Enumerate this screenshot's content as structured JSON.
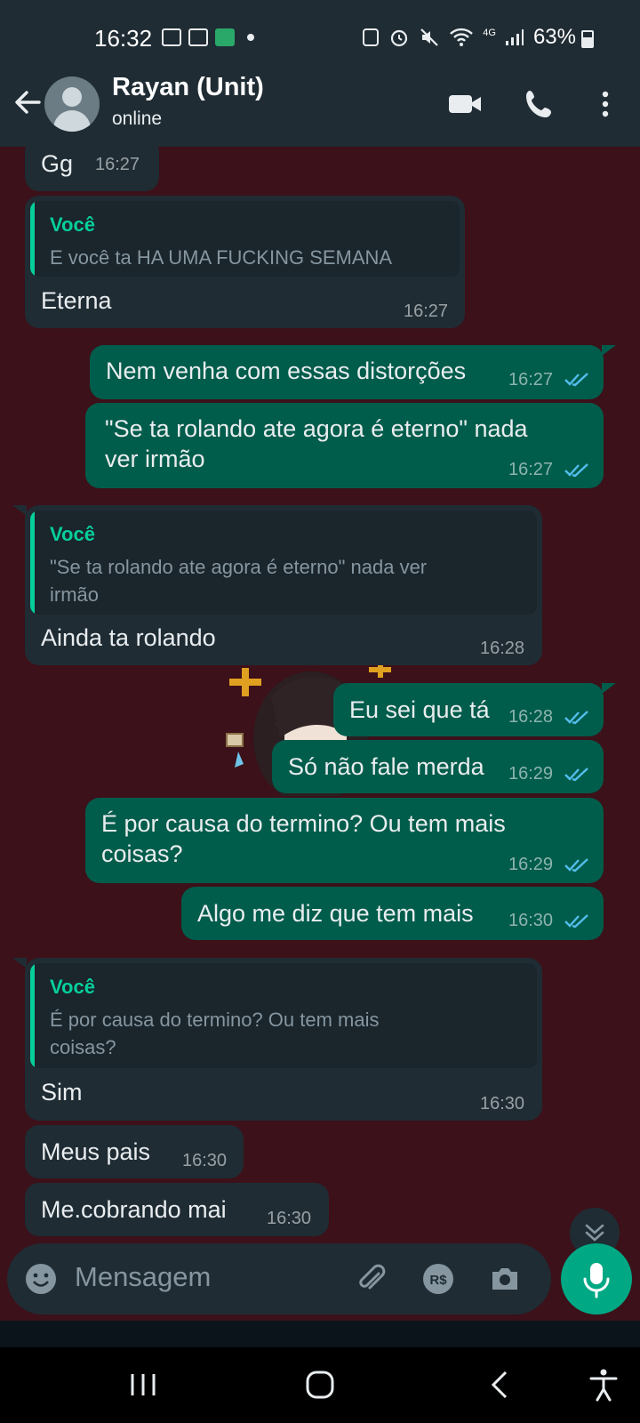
{
  "status_bar": {
    "time": "16:32",
    "network": "4G",
    "battery": "63%",
    "battery_level": 0.63,
    "left_icons": [
      "gallery-icon",
      "screen-share-icon",
      "brain-app-icon"
    ],
    "right_icons": [
      "recycle-icon",
      "alarm-icon",
      "mute-icon",
      "wifi-icon",
      "signal-icon",
      "battery-icon"
    ]
  },
  "header": {
    "contact_name": "Rayan (Unit)",
    "contact_status": "online",
    "icons": [
      "back-arrow-icon",
      "video-call-icon",
      "phone-icon",
      "more-vert-icon"
    ]
  },
  "messages": [
    {
      "dir": "in",
      "text": "Gg",
      "time": "16:27"
    },
    {
      "dir": "in",
      "quote_author": "Você",
      "quote_text": "E você ta HA UMA FUCKING SEMANA",
      "text": "Eterna",
      "time": "16:27"
    },
    {
      "dir": "out",
      "text": "Nem venha com essas distorções",
      "time": "16:27",
      "read": true
    },
    {
      "dir": "out",
      "text": "\"Se ta rolando ate agora é eterno\" nada\nver irmão",
      "time": "16:27",
      "read": true
    },
    {
      "dir": "in",
      "quote_author": "Você",
      "quote_text": "\"Se ta rolando ate agora é eterno\" nada ver\nirmão",
      "text": "Ainda ta rolando",
      "time": "16:28"
    },
    {
      "dir": "out",
      "text": "Eu sei que tá",
      "time": "16:28",
      "read": true
    },
    {
      "dir": "out",
      "text": "Só não fale merda",
      "time": "16:29",
      "read": true
    },
    {
      "dir": "out",
      "text": "É por causa do termino? Ou tem mais\ncoisas?",
      "time": "16:29",
      "read": true
    },
    {
      "dir": "out",
      "text": "Algo me diz que tem mais",
      "time": "16:30",
      "read": true
    },
    {
      "dir": "in",
      "quote_author": "Você",
      "quote_text": "É por causa do termino? Ou tem mais\ncoisas?",
      "text": "Sim",
      "time": "16:30"
    },
    {
      "dir": "in",
      "text": "Meus pais",
      "time": "16:30"
    },
    {
      "dir": "in",
      "text": "Me.cobrando mai",
      "time": "16:30"
    }
  ],
  "compose": {
    "placeholder": "Mensagem",
    "icons": [
      "emoji-icon",
      "attach-icon",
      "payment-icon",
      "camera-icon",
      "mic-icon"
    ]
  },
  "navigation": {
    "icons": [
      "recent-apps-icon",
      "home-icon",
      "back-icon",
      "accessibility-icon"
    ]
  },
  "colors": {
    "header_bg": "#1f2c34",
    "chat_wallpaper": "#3c1119",
    "incoming_bubble": "#1f2c34",
    "outgoing_bubble": "#005c4b",
    "accent_green": "#00a884",
    "quote_author": "#06cf9c",
    "read_ticks": "#53bdeb"
  }
}
